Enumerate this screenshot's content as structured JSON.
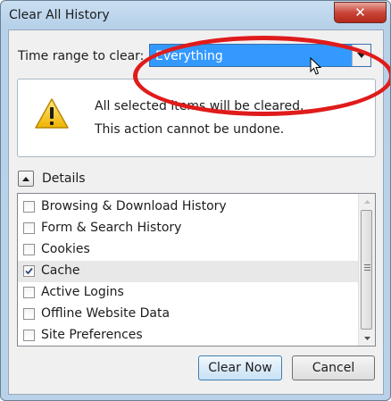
{
  "window": {
    "title": "Clear All History",
    "close_glyph": "✕"
  },
  "time_range": {
    "label": "Time range to clear:",
    "selected": "Everything"
  },
  "warning": {
    "icon": "warning-icon",
    "line1": "All selected items will be cleared.",
    "line2": "This action cannot be undone."
  },
  "details": {
    "label": "Details",
    "expanded": true
  },
  "items": [
    {
      "label": "Browsing & Download History",
      "checked": false
    },
    {
      "label": "Form & Search History",
      "checked": false
    },
    {
      "label": "Cookies",
      "checked": false
    },
    {
      "label": "Cache",
      "checked": true
    },
    {
      "label": "Active Logins",
      "checked": false
    },
    {
      "label": "Offline Website Data",
      "checked": false
    },
    {
      "label": "Site Preferences",
      "checked": false
    }
  ],
  "buttons": {
    "clear_now": "Clear Now",
    "cancel": "Cancel"
  },
  "colors": {
    "selection": "#3399ff",
    "annotation": "#e01b1b",
    "close": "#c9473a"
  }
}
